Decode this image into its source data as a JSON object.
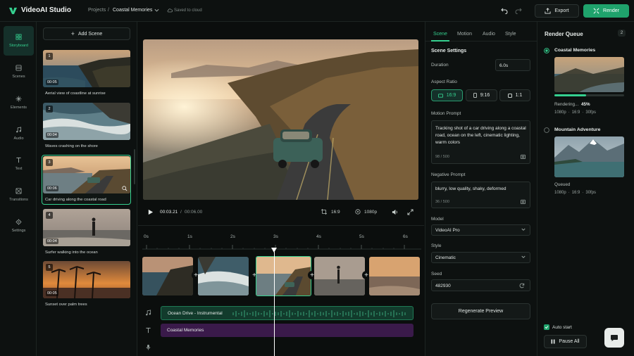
{
  "app": {
    "name": "VideoAI Studio"
  },
  "header": {
    "breadcrumb_root": "Projects",
    "breadcrumb_sep": "/",
    "project": "Coastal Memories",
    "saved": "Saved to cloud",
    "export_label": "Export",
    "render_label": "Render"
  },
  "nav": [
    {
      "label": "Storyboard",
      "icon": "grid-icon"
    },
    {
      "label": "Scenes",
      "icon": "film-icon"
    },
    {
      "label": "Elements",
      "icon": "sparkle-icon"
    },
    {
      "label": "Audio",
      "icon": "music-icon"
    },
    {
      "label": "Text",
      "icon": "text-icon"
    },
    {
      "label": "Transitions",
      "icon": "transition-icon"
    },
    {
      "label": "Settings",
      "icon": "gear-icon"
    }
  ],
  "scenes_panel": {
    "add_label": "Add Scene",
    "items": [
      {
        "num": "1",
        "duration": "00:05",
        "caption": "Aerial view of coastline at sunrise"
      },
      {
        "num": "2",
        "duration": "00:04",
        "caption": "Waves crashing on the shore"
      },
      {
        "num": "3",
        "duration": "00:06",
        "caption": "Car driving along the coastal road"
      },
      {
        "num": "4",
        "duration": "00:04",
        "caption": "Surfer walking into the ocean"
      },
      {
        "num": "5",
        "duration": "00:05",
        "caption": "Sunset over palm trees"
      }
    ]
  },
  "player": {
    "current": "00:03.21",
    "sep": "/",
    "total": "00:06.00",
    "aspect": "16:9",
    "resolution": "1080p"
  },
  "timeline": {
    "ticks": [
      "0s",
      "1s",
      "2s",
      "3s",
      "4s",
      "5s",
      "6s"
    ],
    "music_track": "Ocean Drive - Instrumental",
    "text_track": "Coastal Memories"
  },
  "inspector": {
    "tabs": [
      "Scene",
      "Motion",
      "Audio",
      "Style"
    ],
    "section_title": "Scene Settings",
    "duration_label": "Duration",
    "duration_value": "6.0s",
    "aspect_label": "Aspect Ratio",
    "aspect_options": [
      "16:9",
      "9:16",
      "1:1"
    ],
    "motion_label": "Motion Prompt",
    "motion_text": "Tracking shot of a car driving along a coastal road, ocean on the left, cinematic lighting, warm colors",
    "motion_count": "98 / 500",
    "negative_label": "Negative Prompt",
    "negative_text": "blurry, low quality, shaky, deformed",
    "negative_count": "36 / 500",
    "model_label": "Model",
    "model_value": "VideoAI Pro",
    "style_label": "Style",
    "style_value": "Cinematic",
    "seed_label": "Seed",
    "seed_value": "482930",
    "regen_label": "Regenerate Preview"
  },
  "queue": {
    "title": "Render Queue",
    "count": "2",
    "items": [
      {
        "name": "Coastal Memories",
        "status": "Rendering...",
        "percent": "45%",
        "progress": 0.45,
        "res": "1080p",
        "ratio": "16:9",
        "fps": "30fps",
        "dot": "·"
      },
      {
        "name": "Mountain Adventure",
        "status": "Queued",
        "res": "1080p",
        "ratio": "16:9",
        "fps": "30fps",
        "dot": "·"
      }
    ],
    "auto_start": "Auto start",
    "pause_label": "Pause All"
  },
  "colors": {
    "accent": "#35d08f",
    "accent_dark": "#1fa36c",
    "bg": "#0c0f0e",
    "panel": "#0d1110"
  }
}
